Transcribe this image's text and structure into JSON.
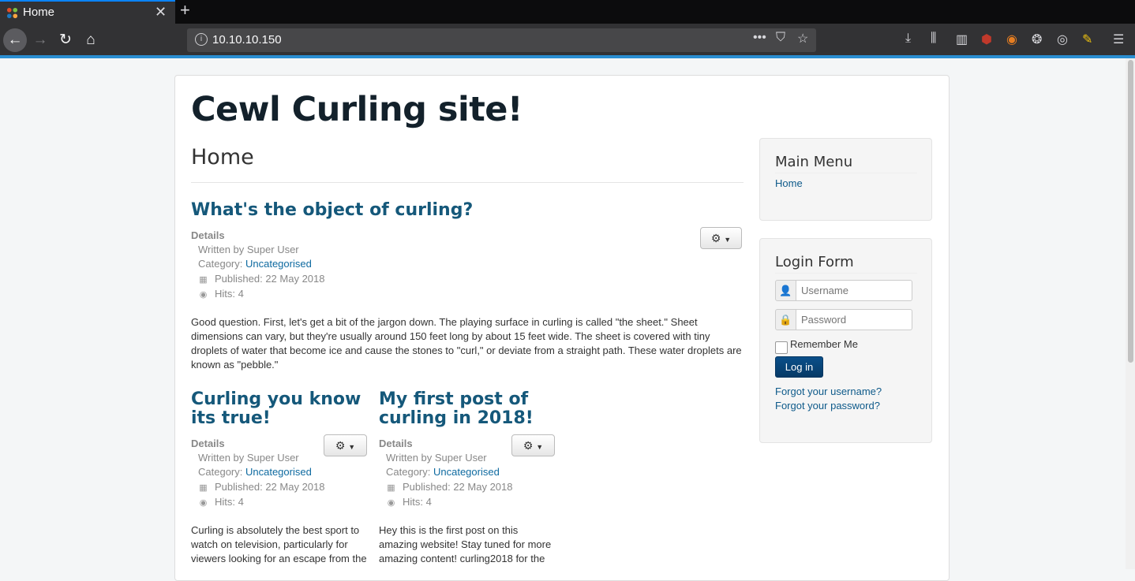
{
  "browser": {
    "tab_title": "Home",
    "url": "10.10.10.150"
  },
  "site": {
    "title": "Cewl Curling site!",
    "page_heading": "Home"
  },
  "articles": [
    {
      "title": "What's the object of curling?",
      "details_label": "Details",
      "author": "Written by Super User",
      "category_label": "Category: ",
      "category": "Uncategorised",
      "published": "Published: 22 May 2018",
      "hits": "Hits: 4",
      "body": "Good question. First, let's get a bit of the jargon down. The playing surface in curling is called \"the sheet.\" Sheet dimensions can vary, but they're usually around 150 feet long by about 15 feet wide. The sheet is covered with tiny droplets of water that become ice and cause the stones to \"curl,\" or deviate from a straight path. These water droplets are known as \"pebble.\""
    },
    {
      "title": "Curling you know its true!",
      "details_label": "Details",
      "author": "Written by Super User",
      "category_label": "Category: ",
      "category": "Uncategorised",
      "published": "Published: 22 May 2018",
      "hits": "Hits: 4",
      "body": "Curling is absolutely the best sport to watch on television, particularly for viewers looking for an escape from the"
    },
    {
      "title": "My first post of curling in 2018!",
      "details_label": "Details",
      "author": "Written by Super User",
      "category_label": "Category: ",
      "category": "Uncategorised",
      "published": "Published: 22 May 2018",
      "hits": "Hits: 4",
      "body": "Hey this is the first post on this amazing website! Stay tuned for more amazing content! curling2018 for the"
    }
  ],
  "sidebar": {
    "main_menu_title": "Main Menu",
    "menu_items": [
      "Home"
    ],
    "login_title": "Login Form",
    "username_placeholder": "Username",
    "password_placeholder": "Password",
    "remember_label": "Remember Me",
    "login_button": "Log in",
    "forgot_username": "Forgot your username?",
    "forgot_password": "Forgot your password?"
  },
  "colors": {
    "link": "#15587a",
    "login_button": "#0a4f8a",
    "accent": "#2a8ed1"
  }
}
